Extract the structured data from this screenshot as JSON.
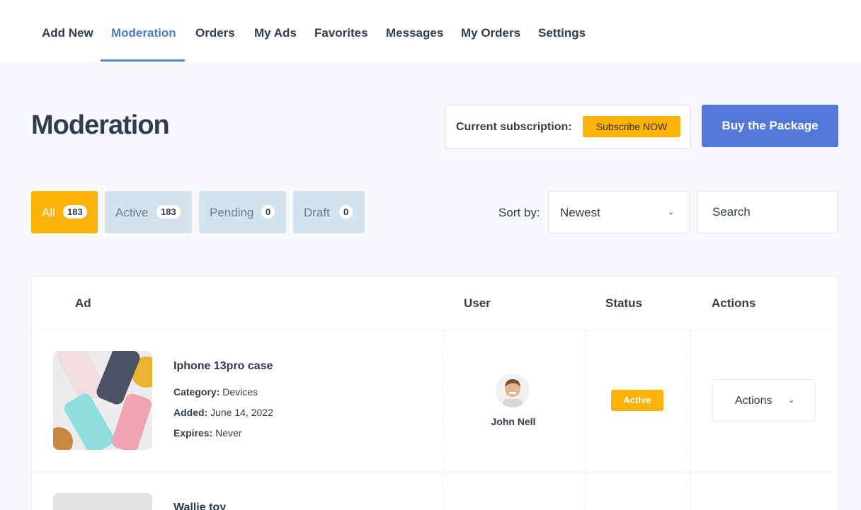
{
  "nav": {
    "items": [
      {
        "label": "Add New"
      },
      {
        "label": "Moderation"
      },
      {
        "label": "Orders"
      },
      {
        "label": "My Ads"
      },
      {
        "label": "Favorites"
      },
      {
        "label": "Messages"
      },
      {
        "label": "My Orders"
      },
      {
        "label": "Settings"
      }
    ],
    "active": "Moderation"
  },
  "page": {
    "title": "Moderation"
  },
  "subscription": {
    "label": "Current subscription:",
    "button": "Subscribe NOW"
  },
  "buy_button": "Buy the Package",
  "filters": [
    {
      "label": "All",
      "count": "183",
      "active": true
    },
    {
      "label": "Active",
      "count": "183",
      "active": false
    },
    {
      "label": "Pending",
      "count": "0",
      "active": false
    },
    {
      "label": "Draft",
      "count": "0",
      "active": false
    }
  ],
  "sort": {
    "label": "Sort by:",
    "value": "Newest"
  },
  "search": {
    "placeholder": "Search"
  },
  "table": {
    "headers": {
      "ad": "Ad",
      "user": "User",
      "status": "Status",
      "actions": "Actions"
    },
    "rows": [
      {
        "title": "Iphone 13pro case",
        "category_label": "Category:",
        "category": "Devices",
        "added_label": "Added:",
        "added": "June 14, 2022",
        "expires_label": "Expires:",
        "expires": "Never",
        "user": "John Nell",
        "status": "Active",
        "actions": "Actions"
      },
      {
        "title": "Wallie toy"
      }
    ]
  },
  "colors": {
    "accent_yellow": "#f9b208",
    "primary_blue": "#5478d9",
    "nav_active": "#4f7ac7",
    "filter_bg": "#d7e3ec"
  }
}
